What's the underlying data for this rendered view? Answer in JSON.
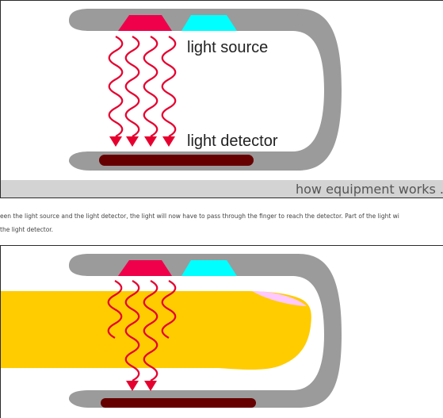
{
  "top_diagram": {
    "labels": {
      "light_source": "light source",
      "light_detector": "light detector"
    },
    "caption": "how equipment works ."
  },
  "body_text": {
    "line_1": "een the light source and the light detector, the light will now have to pass through the finger to reach the detector. Part of the light wi",
    "line_2": "the light detector."
  },
  "colors": {
    "clip_gray": "#9b9b9b",
    "light_source_red": "#f0004b",
    "light_source_cyan": "#00ffff",
    "detector_dark_red": "#660000",
    "wave_red": "#e6002f",
    "finger_yellow": "#ffcc00",
    "nail_pink": "#ffc8ff",
    "caption_bar_gray": "#d3d3d3"
  }
}
